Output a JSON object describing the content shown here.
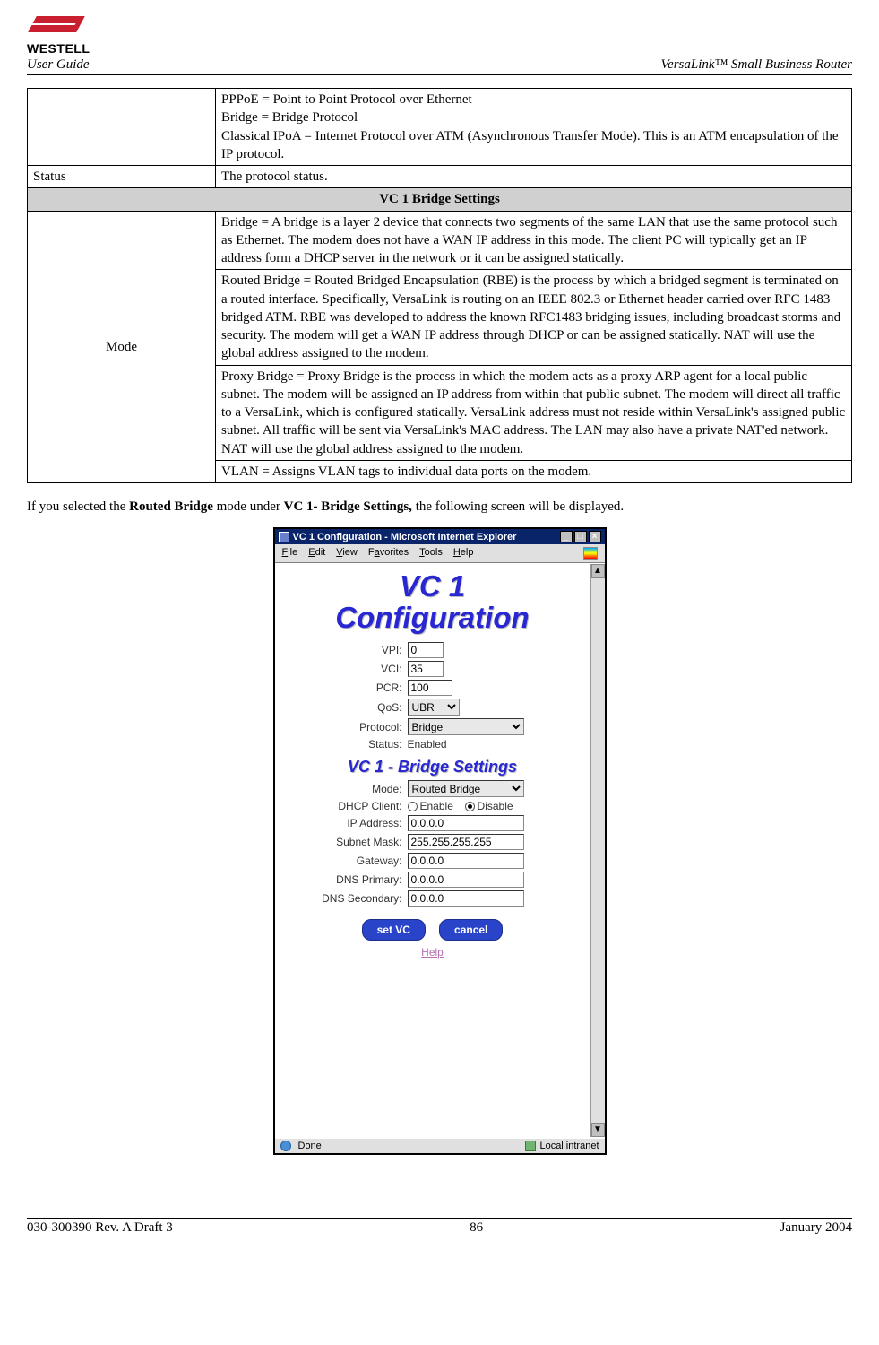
{
  "brand": "WESTELL",
  "header": {
    "user_guide": "User Guide",
    "product": "VersaLink™  Small Business Router"
  },
  "table": {
    "proto_desc": "PPPoE = Point to Point Protocol over Ethernet\nBridge = Bridge Protocol\nClassical IPoA = Internet Protocol over ATM (Asynchronous Transfer Mode). This is an ATM encapsulation of the IP protocol.",
    "status_label": "Status",
    "status_desc": "The protocol status.",
    "section_head": "VC 1 Bridge Settings",
    "mode_label": "Mode",
    "mode_bridge": "Bridge = A bridge is a layer 2 device that connects two segments of the same LAN that use the same protocol such as Ethernet. The modem does not have a WAN IP address in this mode. The client PC will typically get an IP address form a DHCP server in the network or it can be assigned statically.",
    "mode_routed": "Routed Bridge = Routed Bridged Encapsulation (RBE) is the process by which a bridged segment is terminated on a routed interface. Specifically, VersaLink is routing on an IEEE 802.3 or Ethernet header carried over RFC 1483 bridged ATM.  RBE was developed to address the known RFC1483 bridging issues, including broadcast storms and security. The modem will get a WAN IP address through DHCP or can be assigned statically. NAT will use the global address assigned to the modem.",
    "mode_proxy": "Proxy Bridge = Proxy Bridge is the process in which the modem acts as a proxy ARP agent for a local public subnet. The modem will be assigned an IP address from within that public subnet. The modem will direct all traffic to a VersaLink, which is configured statically. VersaLink address must not reside within VersaLink's assigned public subnet. All traffic will be sent via VersaLink's MAC address. The LAN may also have a private NAT'ed network. NAT will use the global address assigned to the modem.",
    "mode_vlan": "VLAN = Assigns VLAN tags to individual data ports on the modem."
  },
  "para": {
    "pre": "If you selected the ",
    "b1": "Routed Bridge",
    "mid": " mode under ",
    "b2": "VC 1- Bridge Settings,",
    "post": " the following screen will be displayed."
  },
  "ie": {
    "title": "VC 1 Configuration - Microsoft Internet Explorer",
    "menu": {
      "file": "File",
      "edit": "Edit",
      "view": "View",
      "fav": "Favorites",
      "tools": "Tools",
      "help": "Help"
    },
    "h1_line1": "VC 1",
    "h1_line2": "Configuration",
    "h2": "VC 1 - Bridge Settings",
    "labels": {
      "vpi": "VPI:",
      "vci": "VCI:",
      "pcr": "PCR:",
      "qos": "QoS:",
      "protocol": "Protocol:",
      "status": "Status:",
      "mode": "Mode:",
      "dhcp": "DHCP Client:",
      "ip": "IP Address:",
      "subnet": "Subnet Mask:",
      "gateway": "Gateway:",
      "dns1": "DNS Primary:",
      "dns2": "DNS Secondary:"
    },
    "values": {
      "vpi": "0",
      "vci": "35",
      "pcr": "100",
      "qos": "UBR",
      "protocol": "Bridge",
      "status_text": "Enabled",
      "mode": "Routed Bridge",
      "dhcp_enable": "Enable",
      "dhcp_disable": "Disable",
      "ip": "0.0.0.0",
      "subnet": "255.255.255.255",
      "gateway": "0.0.0.0",
      "dns1": "0.0.0.0",
      "dns2": "0.0.0.0"
    },
    "buttons": {
      "set": "set VC",
      "cancel": "cancel"
    },
    "help": "Help",
    "status_done": "Done",
    "status_zone": "Local intranet"
  },
  "footer": {
    "left": "030-300390 Rev. A Draft 3",
    "center": "86",
    "right": "January 2004"
  }
}
